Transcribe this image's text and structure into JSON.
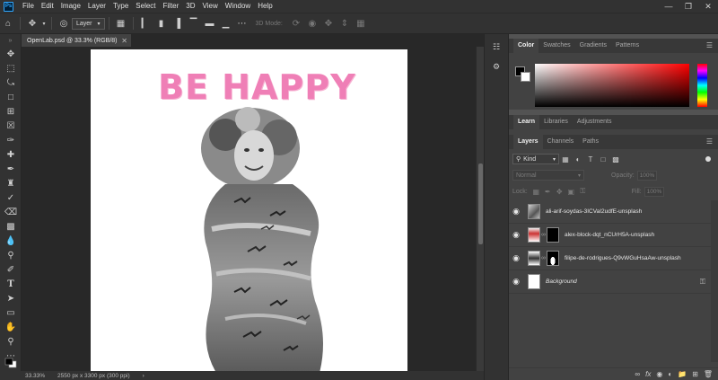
{
  "app": {
    "logo": "Ps"
  },
  "menu": [
    "File",
    "Edit",
    "Image",
    "Layer",
    "Type",
    "Select",
    "Filter",
    "3D",
    "View",
    "Window",
    "Help"
  ],
  "options_bar": {
    "layer_select": "Layer",
    "mode_3d": "3D Mode:"
  },
  "document": {
    "tab_title": "OpenLab.psd @ 33.3% (RGB/8)",
    "headline": "BE HAPPY"
  },
  "status": {
    "zoom": "33.33%",
    "doc_size": "2550 px x 3300 px (300 ppi)"
  },
  "color_panel": {
    "tabs": [
      "Color",
      "Swatches",
      "Gradients",
      "Patterns"
    ],
    "active_tab": "Color",
    "foreground": "#000000",
    "background": "#ffffff",
    "hue": "#ff0000"
  },
  "learn_panel": {
    "tabs": [
      "Learn",
      "Libraries",
      "Adjustments"
    ]
  },
  "layers_panel": {
    "tabs": [
      "Layers",
      "Channels",
      "Paths"
    ],
    "filter_kind": "Kind",
    "blend_mode": "Normal",
    "opacity_label": "Opacity:",
    "opacity_value": "100%",
    "lock_label": "Lock:",
    "fill_label": "Fill:",
    "fill_value": "100%",
    "layers": [
      {
        "name": "ali-arif-soydas-3ICVaI2udfE-unsplash",
        "has_mask": false,
        "italic": false
      },
      {
        "name": "alex-block-dqt_nCUrH5A-unsplash",
        "has_mask": true,
        "italic": false
      },
      {
        "name": "filipe-de-rodrigues-Q9vWGuHsaAw-unsplash",
        "has_mask": true,
        "italic": false
      },
      {
        "name": "Background",
        "has_mask": false,
        "italic": true,
        "locked": true
      }
    ]
  },
  "accent": {
    "headline_pink": "#ef7fb6"
  }
}
